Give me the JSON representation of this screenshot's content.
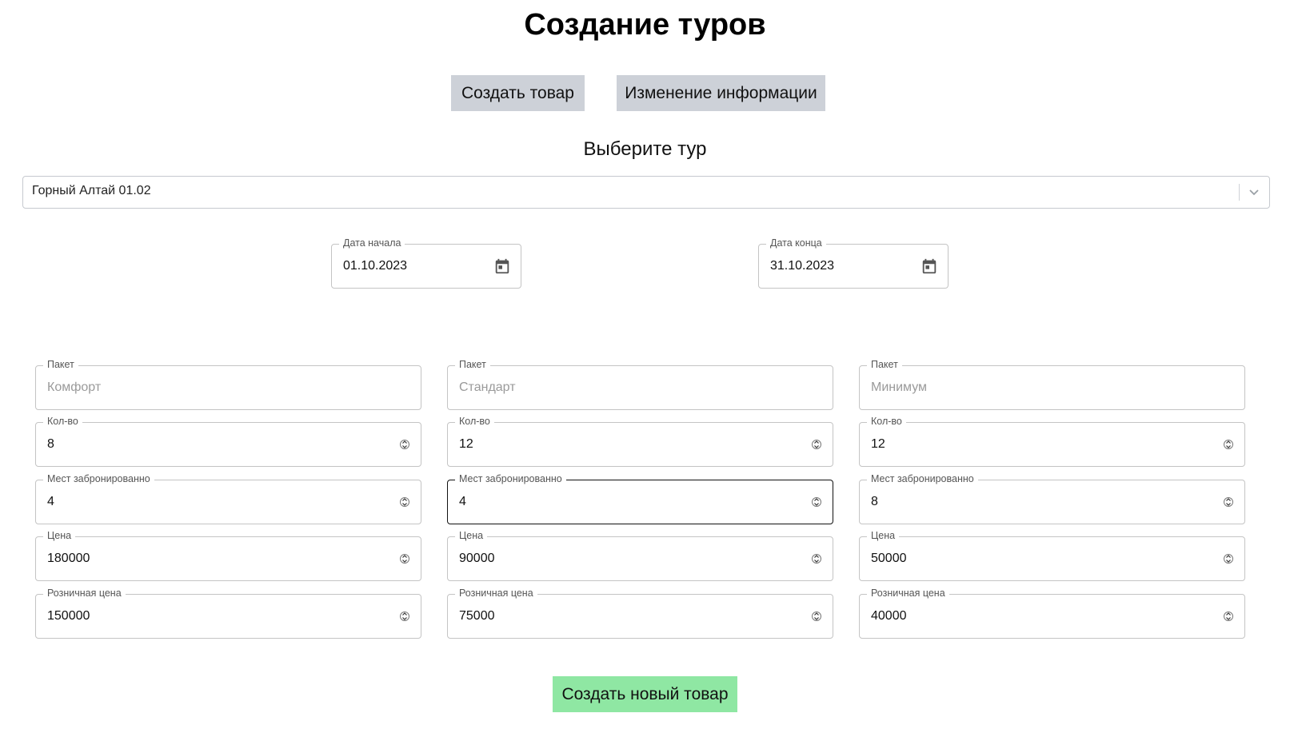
{
  "page": {
    "title": "Создание туров"
  },
  "nav": {
    "create_label": "Создать товар",
    "edit_label": "Изменение информации"
  },
  "tour_select": {
    "heading": "Выберите тур",
    "value": "Горный Алтай 01.02"
  },
  "dates": {
    "start": {
      "label": "Дата начала",
      "value": "01.10.2023"
    },
    "end": {
      "label": "Дата конца",
      "value": "31.10.2023"
    }
  },
  "labels": {
    "package": "Пакет",
    "quantity": "Кол-во",
    "booked": "Мест забронированно",
    "price": "Цена",
    "retail": "Розничная цена"
  },
  "packages": [
    {
      "placeholder": "Комфорт",
      "quantity": "8",
      "booked": "4",
      "price": "180000",
      "retail": "150000"
    },
    {
      "placeholder": "Стандарт",
      "quantity": "12",
      "booked": "4",
      "price": "90000",
      "retail": "75000"
    },
    {
      "placeholder": "Минимум",
      "quantity": "12",
      "booked": "8",
      "price": "50000",
      "retail": "40000"
    }
  ],
  "submit": {
    "label": "Создать новый товар"
  },
  "colors": {
    "nav_button_bg": "#cdd1d8",
    "submit_bg": "#8fe7a3",
    "focused_border": "#111111"
  },
  "icons": {
    "select_arrow": "chevron-down-icon",
    "date_picker": "calendar-icon",
    "number_stepper": "spinner-arrows-icon"
  }
}
